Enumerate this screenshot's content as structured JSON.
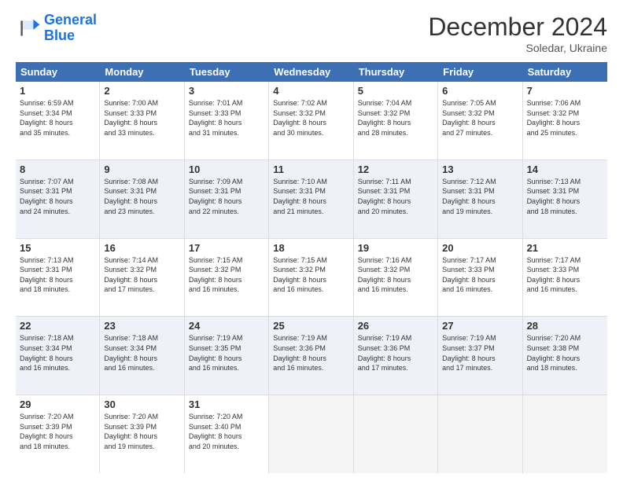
{
  "logo": {
    "line1": "General",
    "line2": "Blue"
  },
  "title": "December 2024",
  "location": "Soledar, Ukraine",
  "days_of_week": [
    "Sunday",
    "Monday",
    "Tuesday",
    "Wednesday",
    "Thursday",
    "Friday",
    "Saturday"
  ],
  "weeks": [
    [
      {
        "num": "1",
        "info": "Sunrise: 6:59 AM\nSunset: 3:34 PM\nDaylight: 8 hours\nand 35 minutes.",
        "alt": false
      },
      {
        "num": "2",
        "info": "Sunrise: 7:00 AM\nSunset: 3:33 PM\nDaylight: 8 hours\nand 33 minutes.",
        "alt": false
      },
      {
        "num": "3",
        "info": "Sunrise: 7:01 AM\nSunset: 3:33 PM\nDaylight: 8 hours\nand 31 minutes.",
        "alt": false
      },
      {
        "num": "4",
        "info": "Sunrise: 7:02 AM\nSunset: 3:32 PM\nDaylight: 8 hours\nand 30 minutes.",
        "alt": false
      },
      {
        "num": "5",
        "info": "Sunrise: 7:04 AM\nSunset: 3:32 PM\nDaylight: 8 hours\nand 28 minutes.",
        "alt": false
      },
      {
        "num": "6",
        "info": "Sunrise: 7:05 AM\nSunset: 3:32 PM\nDaylight: 8 hours\nand 27 minutes.",
        "alt": false
      },
      {
        "num": "7",
        "info": "Sunrise: 7:06 AM\nSunset: 3:32 PM\nDaylight: 8 hours\nand 25 minutes.",
        "alt": false
      }
    ],
    [
      {
        "num": "8",
        "info": "Sunrise: 7:07 AM\nSunset: 3:31 PM\nDaylight: 8 hours\nand 24 minutes.",
        "alt": true
      },
      {
        "num": "9",
        "info": "Sunrise: 7:08 AM\nSunset: 3:31 PM\nDaylight: 8 hours\nand 23 minutes.",
        "alt": true
      },
      {
        "num": "10",
        "info": "Sunrise: 7:09 AM\nSunset: 3:31 PM\nDaylight: 8 hours\nand 22 minutes.",
        "alt": true
      },
      {
        "num": "11",
        "info": "Sunrise: 7:10 AM\nSunset: 3:31 PM\nDaylight: 8 hours\nand 21 minutes.",
        "alt": true
      },
      {
        "num": "12",
        "info": "Sunrise: 7:11 AM\nSunset: 3:31 PM\nDaylight: 8 hours\nand 20 minutes.",
        "alt": true
      },
      {
        "num": "13",
        "info": "Sunrise: 7:12 AM\nSunset: 3:31 PM\nDaylight: 8 hours\nand 19 minutes.",
        "alt": true
      },
      {
        "num": "14",
        "info": "Sunrise: 7:13 AM\nSunset: 3:31 PM\nDaylight: 8 hours\nand 18 minutes.",
        "alt": true
      }
    ],
    [
      {
        "num": "15",
        "info": "Sunrise: 7:13 AM\nSunset: 3:31 PM\nDaylight: 8 hours\nand 18 minutes.",
        "alt": false
      },
      {
        "num": "16",
        "info": "Sunrise: 7:14 AM\nSunset: 3:32 PM\nDaylight: 8 hours\nand 17 minutes.",
        "alt": false
      },
      {
        "num": "17",
        "info": "Sunrise: 7:15 AM\nSunset: 3:32 PM\nDaylight: 8 hours\nand 16 minutes.",
        "alt": false
      },
      {
        "num": "18",
        "info": "Sunrise: 7:15 AM\nSunset: 3:32 PM\nDaylight: 8 hours\nand 16 minutes.",
        "alt": false
      },
      {
        "num": "19",
        "info": "Sunrise: 7:16 AM\nSunset: 3:32 PM\nDaylight: 8 hours\nand 16 minutes.",
        "alt": false
      },
      {
        "num": "20",
        "info": "Sunrise: 7:17 AM\nSunset: 3:33 PM\nDaylight: 8 hours\nand 16 minutes.",
        "alt": false
      },
      {
        "num": "21",
        "info": "Sunrise: 7:17 AM\nSunset: 3:33 PM\nDaylight: 8 hours\nand 16 minutes.",
        "alt": false
      }
    ],
    [
      {
        "num": "22",
        "info": "Sunrise: 7:18 AM\nSunset: 3:34 PM\nDaylight: 8 hours\nand 16 minutes.",
        "alt": true
      },
      {
        "num": "23",
        "info": "Sunrise: 7:18 AM\nSunset: 3:34 PM\nDaylight: 8 hours\nand 16 minutes.",
        "alt": true
      },
      {
        "num": "24",
        "info": "Sunrise: 7:19 AM\nSunset: 3:35 PM\nDaylight: 8 hours\nand 16 minutes.",
        "alt": true
      },
      {
        "num": "25",
        "info": "Sunrise: 7:19 AM\nSunset: 3:36 PM\nDaylight: 8 hours\nand 16 minutes.",
        "alt": true
      },
      {
        "num": "26",
        "info": "Sunrise: 7:19 AM\nSunset: 3:36 PM\nDaylight: 8 hours\nand 17 minutes.",
        "alt": true
      },
      {
        "num": "27",
        "info": "Sunrise: 7:19 AM\nSunset: 3:37 PM\nDaylight: 8 hours\nand 17 minutes.",
        "alt": true
      },
      {
        "num": "28",
        "info": "Sunrise: 7:20 AM\nSunset: 3:38 PM\nDaylight: 8 hours\nand 18 minutes.",
        "alt": true
      }
    ],
    [
      {
        "num": "29",
        "info": "Sunrise: 7:20 AM\nSunset: 3:39 PM\nDaylight: 8 hours\nand 18 minutes.",
        "alt": false
      },
      {
        "num": "30",
        "info": "Sunrise: 7:20 AM\nSunset: 3:39 PM\nDaylight: 8 hours\nand 19 minutes.",
        "alt": false
      },
      {
        "num": "31",
        "info": "Sunrise: 7:20 AM\nSunset: 3:40 PM\nDaylight: 8 hours\nand 20 minutes.",
        "alt": false
      },
      {
        "num": "",
        "info": "",
        "alt": false,
        "empty": true
      },
      {
        "num": "",
        "info": "",
        "alt": false,
        "empty": true
      },
      {
        "num": "",
        "info": "",
        "alt": false,
        "empty": true
      },
      {
        "num": "",
        "info": "",
        "alt": false,
        "empty": true
      }
    ]
  ]
}
